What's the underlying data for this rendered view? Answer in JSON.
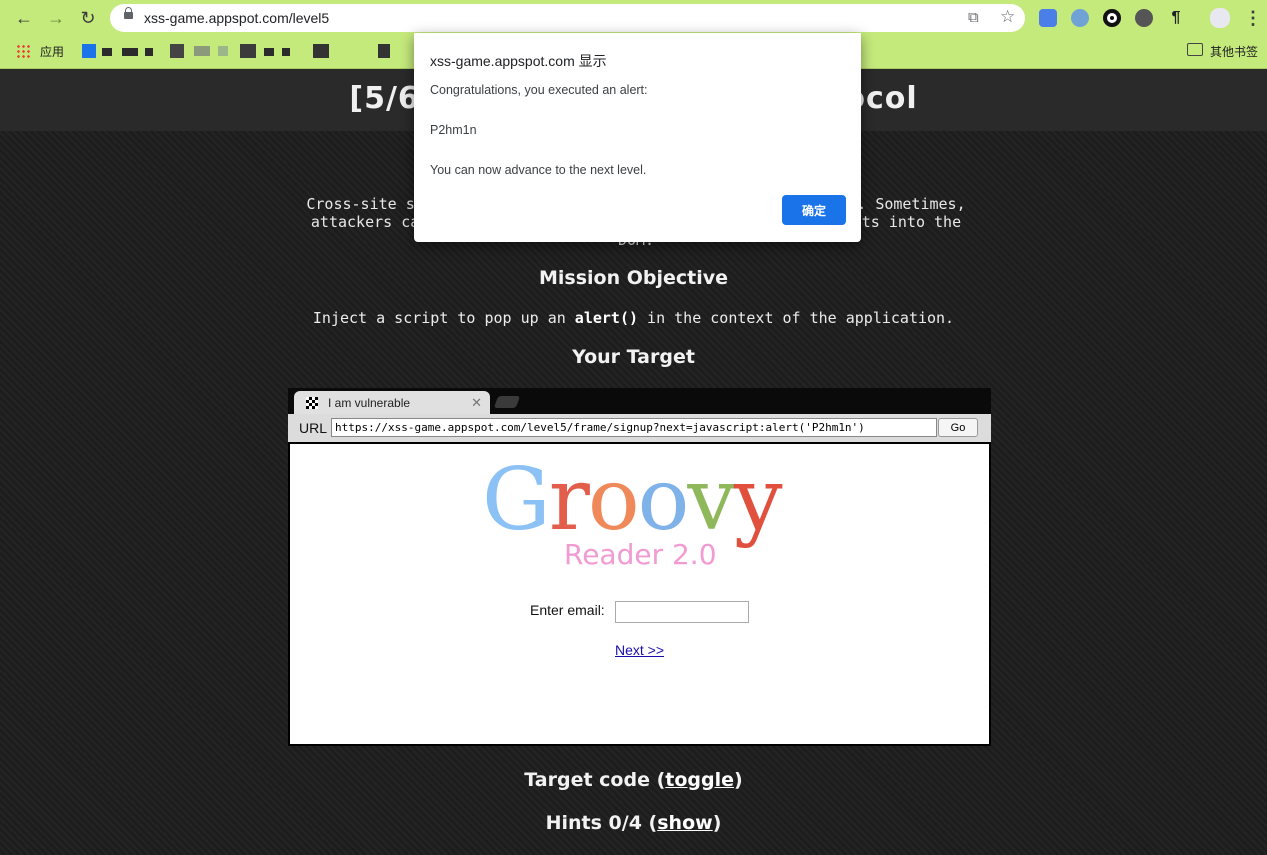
{
  "browser": {
    "url": "xss-game.appspot.com/level5",
    "bookmark_apps_label": "应用",
    "other_bookmarks_label": "其他书签"
  },
  "page": {
    "title": "[5/6] Level 5: Breaking protocol",
    "description_line1": "Cross-site scripting isn't just about correctly escaping data. Sometimes,",
    "description_line2": "attackers can do bad things even without injecting new elements into the",
    "description_line3": "DOM.",
    "mission_heading": "Mission Objective",
    "objective_prefix": "Inject a script to pop up an",
    "objective_code": "alert()",
    "objective_suffix": "in the context of the application.",
    "target_heading": "Your Target",
    "target_code_label": "Target code (",
    "toggle_link": "toggle",
    "hints_label": "Hints 0/4 (",
    "show_link": "show",
    "close_paren": ")"
  },
  "frame": {
    "tab_title": "I am vulnerable",
    "url_label": "URL",
    "url_value": "https://xss-game.appspot.com/level5/frame/signup?next=javascript:alert('P2hm1n')",
    "go_label": "Go",
    "logo_letters": [
      "G",
      "r",
      "o",
      "o",
      "v",
      "y"
    ],
    "logo_subtitle": "Reader 2.0",
    "email_label": "Enter email:",
    "next_link": "Next >>"
  },
  "dialog": {
    "title": "xss-game.appspot.com 显示",
    "line1": "Congratulations, you executed an alert:",
    "line2": "P2hm1n",
    "line3": "You can now advance to the next level.",
    "ok_label": "确定"
  }
}
